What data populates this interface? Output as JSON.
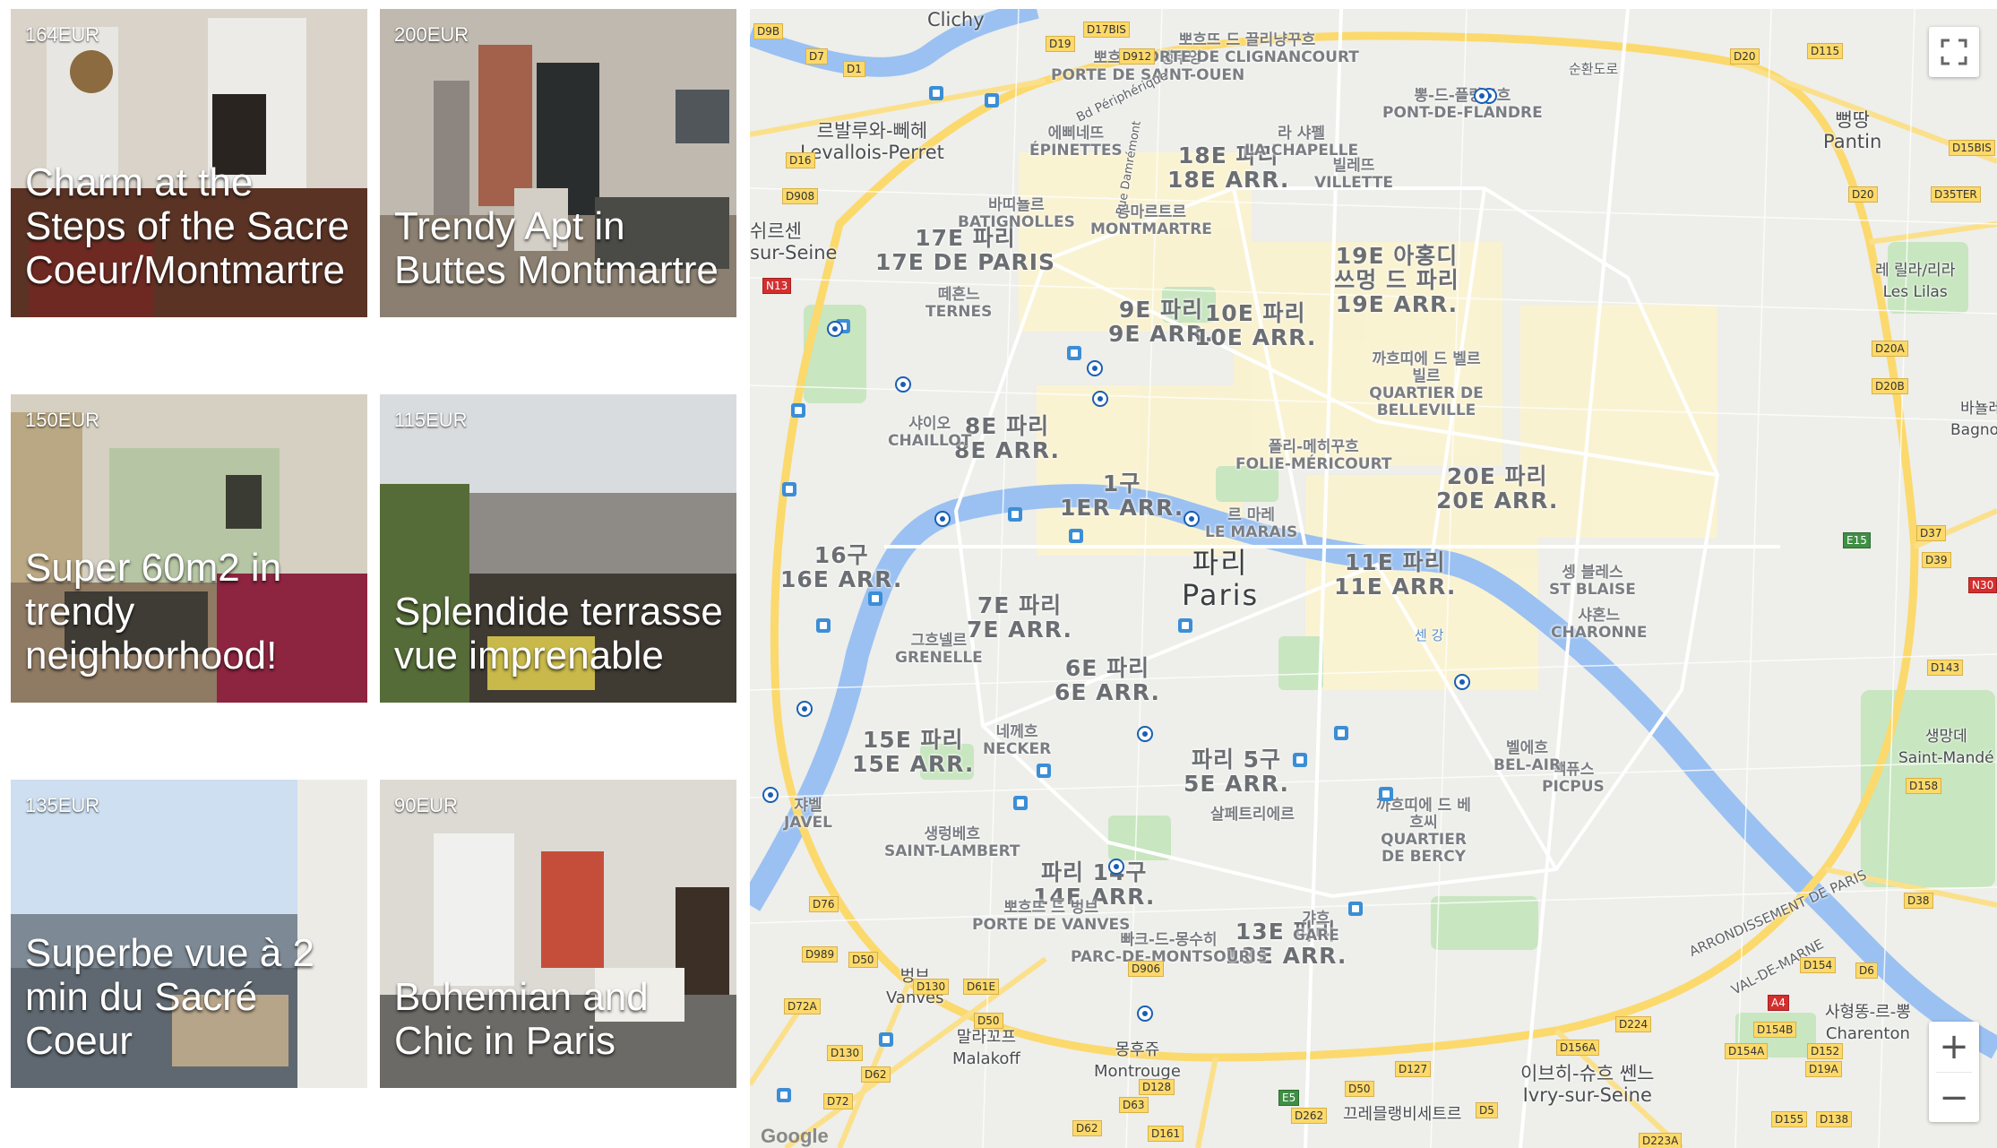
{
  "listings": [
    {
      "price": "164EUR",
      "title": "Charm at the Steps of the Sacre Coeur/Montmartre"
    },
    {
      "price": "200EUR",
      "title": "Trendy Apt in Buttes Montmartre"
    },
    {
      "price": "150EUR",
      "title": "Super 60m2 in trendy neighborhood!"
    },
    {
      "price": "115EUR",
      "title": "Splendide terrasse vue imprenable"
    },
    {
      "price": "135EUR",
      "title": "Superbe vue à 2 min du Sacré Coeur"
    },
    {
      "price": "90EUR",
      "title": "Bohemian and Chic in Paris"
    }
  ],
  "map": {
    "center": {
      "ko": "파리",
      "en": "Paris"
    },
    "arrondissements": [
      {
        "ko": "18E 파리",
        "en": "18E ARR."
      },
      {
        "ko": "17E 파리",
        "en": "17E DE PARIS"
      },
      {
        "ko": "9E 파리",
        "en": "9E ARR."
      },
      {
        "ko": "10E 파리",
        "en": "10E ARR."
      },
      {
        "ko": "19E 아홍디 쓰멍 드 파리",
        "en": "19E ARR."
      },
      {
        "ko": "8E 파리",
        "en": "8E ARR."
      },
      {
        "ko": "1구",
        "en": "1ER ARR."
      },
      {
        "ko": "20E 파리",
        "en": "20E ARR."
      },
      {
        "ko": "16구",
        "en": "16E ARR."
      },
      {
        "ko": "11E 파리",
        "en": "11E ARR."
      },
      {
        "ko": "7E 파리",
        "en": "7E ARR."
      },
      {
        "ko": "6E 파리",
        "en": "6E ARR."
      },
      {
        "ko": "15E 파리",
        "en": "15E ARR."
      },
      {
        "ko": "파리 5구",
        "en": "5E ARR."
      },
      {
        "ko": "파리 14구",
        "en": "14E ARR."
      },
      {
        "ko": "13E 파리",
        "en": "13E ARR."
      }
    ],
    "neighborhoods": [
      {
        "ko": "뽀흐뜨 드 생뚜엉",
        "en": "PORTE DE SAINT-OUEN"
      },
      {
        "ko": "뽀흐뜨 드 끌리냥꾸흐",
        "en": "PORTE DE CLIGNANCOURT"
      },
      {
        "ko": "에삐네뜨",
        "en": "ÉPINETTES"
      },
      {
        "ko": "라 샤펠",
        "en": "LA CHAPELLE"
      },
      {
        "ko": "뽕-드-플랑드흐",
        "en": "PONT-DE-FLANDRE"
      },
      {
        "ko": "빌레뜨",
        "en": "VILLETTE"
      },
      {
        "ko": "바띠뇰르",
        "en": "BATIGNOLLES"
      },
      {
        "ko": "몽마르트르",
        "en": "MONTMARTRE"
      },
      {
        "ko": "떼흔느",
        "en": "TERNES"
      },
      {
        "ko": "까흐띠에 드 벨르빌르",
        "en": "QUARTIER DE BELLEVILLE"
      },
      {
        "ko": "샤이오",
        "en": "CHAILLOT"
      },
      {
        "ko": "폴리-메히꾸흐",
        "en": "FOLIE-MÉRICOURT"
      },
      {
        "ko": "르 마레",
        "en": "LE MARAIS"
      },
      {
        "ko": "그흐넬르",
        "en": "GRENELLE"
      },
      {
        "ko": "셍 블레스",
        "en": "ST BLAISE"
      },
      {
        "ko": "샤혼느",
        "en": "CHARONNE"
      },
      {
        "ko": "네께흐",
        "en": "NECKER"
      },
      {
        "ko": "빽퓨스",
        "en": "PICPUS"
      },
      {
        "ko": "쟈벨",
        "en": "JAVEL"
      },
      {
        "ko": "생렁베흐",
        "en": "SAINT-LAMBERT"
      },
      {
        "ko": "살페트리에르",
        "en": "SALPÊTRIÈRE"
      },
      {
        "ko": "까흐띠에 드 베흐씨",
        "en": "QUARTIER DE BERCY"
      },
      {
        "ko": "뽀흐뜨 드 벙브",
        "en": "PORTE DE VANVES"
      },
      {
        "ko": "빠크-드-몽수히",
        "en": "PARC-DE-MONTSOURIS"
      },
      {
        "ko": "갸흐",
        "en": "GARE"
      },
      {
        "ko": "벨에흐",
        "en": "BEL-AIR"
      }
    ],
    "cities": [
      {
        "ko": "",
        "en": "Clichy"
      },
      {
        "ko": "르발루와-뻬헤",
        "en": "Levallois-Perret"
      },
      {
        "ko": "쉬르센",
        "en": "sur-Seine"
      },
      {
        "ko": "뻥땅",
        "en": "Pantin"
      },
      {
        "ko": "레 릴라/리라",
        "en": "Les Lilas"
      },
      {
        "ko": "바뇰레",
        "en": "Bagnole"
      },
      {
        "ko": "생망데",
        "en": "Saint-Mandé"
      },
      {
        "ko": "벙브",
        "en": "Vanves"
      },
      {
        "ko": "말라꼬프",
        "en": "Malakoff"
      },
      {
        "ko": "몽후쥬",
        "en": "Montrouge"
      },
      {
        "ko": "사형똥-르-뽕",
        "en": "Charenton"
      },
      {
        "ko": "이브히-슈흐 쎈느",
        "en": "Ivry-sur-Seine"
      },
      {
        "ko": "끄레믈랭비세트르",
        "en": ""
      }
    ],
    "road_labels": [
      "D9B",
      "D19",
      "D17BIS",
      "D912",
      "D7",
      "D1",
      "D16",
      "D908",
      "N13",
      "D20",
      "D115",
      "D15BIS",
      "D20",
      "D35TER",
      "D20A",
      "D20B",
      "D37",
      "D39",
      "N30",
      "D143",
      "D158",
      "D38",
      "D154",
      "D6",
      "A4",
      "D154B",
      "D152",
      "D19A",
      "D155",
      "D138",
      "D224",
      "D156A",
      "D154A",
      "D76",
      "D989",
      "D50",
      "D130",
      "D61E",
      "D72A",
      "D130",
      "D62",
      "D72",
      "D906",
      "D50",
      "D128",
      "D63",
      "D161",
      "D62",
      "D127",
      "D50",
      "E5",
      "D262",
      "D5",
      "D223A",
      "E15"
    ],
    "river_label": "센 강",
    "boulevard_labels": [
      "Bd Périphérique",
      "ARRONDISSEMENT DE PARIS",
      "VAL-DE-MARNE",
      "순환도로",
      "Rue Damrémont"
    ]
  },
  "controls": {
    "zoom_in": "+",
    "zoom_out": "−",
    "attribution": "Google"
  },
  "colors": {
    "river": "#8ab4f8",
    "park": "#c8e6c0",
    "primary_road": "#fbd96c",
    "road_label": "#fcd96a",
    "map_bg": "#eeeeea"
  }
}
